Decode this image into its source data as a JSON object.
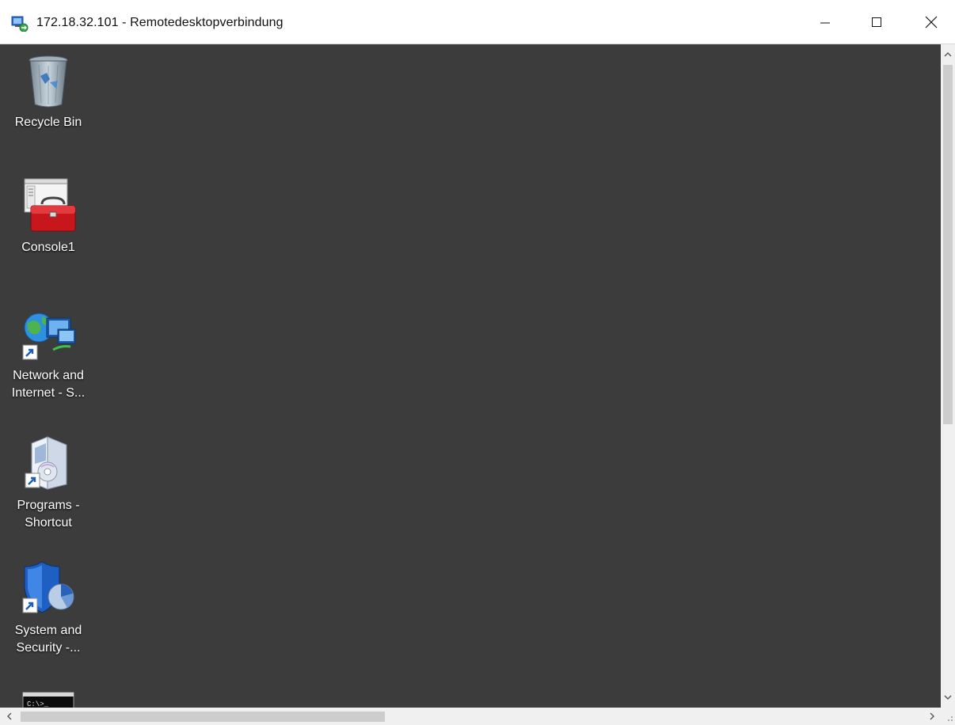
{
  "window": {
    "title": "172.18.32.101 - Remotedesktopverbindung",
    "icon": "remote-desktop-icon",
    "controls": {
      "minimize": "minimize-icon",
      "maximize": "maximize-icon",
      "close": "close-icon"
    }
  },
  "desktop": {
    "background_color": "#3c3c3c",
    "icons": [
      {
        "id": "recycle-bin",
        "label": "Recycle Bin",
        "icon": "recycle-bin-icon"
      },
      {
        "id": "console1",
        "label": "Console1",
        "icon": "toolbox-icon"
      },
      {
        "id": "network",
        "label_line1": "Network and",
        "label_line2": "Internet - S...",
        "icon": "network-icon",
        "shortcut": true
      },
      {
        "id": "programs",
        "label_line1": "Programs -",
        "label_line2": "Shortcut",
        "icon": "programs-icon",
        "shortcut": true
      },
      {
        "id": "security",
        "label_line1": "System and",
        "label_line2": "Security -...",
        "icon": "shield-icon",
        "shortcut": true
      },
      {
        "id": "cmd",
        "label": "",
        "icon": "command-prompt-icon"
      }
    ]
  },
  "scrollbars": {
    "vertical": {
      "up": "chevron-up-icon",
      "down": "chevron-down-icon"
    },
    "horizontal": {
      "left": "chevron-left-icon",
      "right": "chevron-right-icon"
    }
  }
}
